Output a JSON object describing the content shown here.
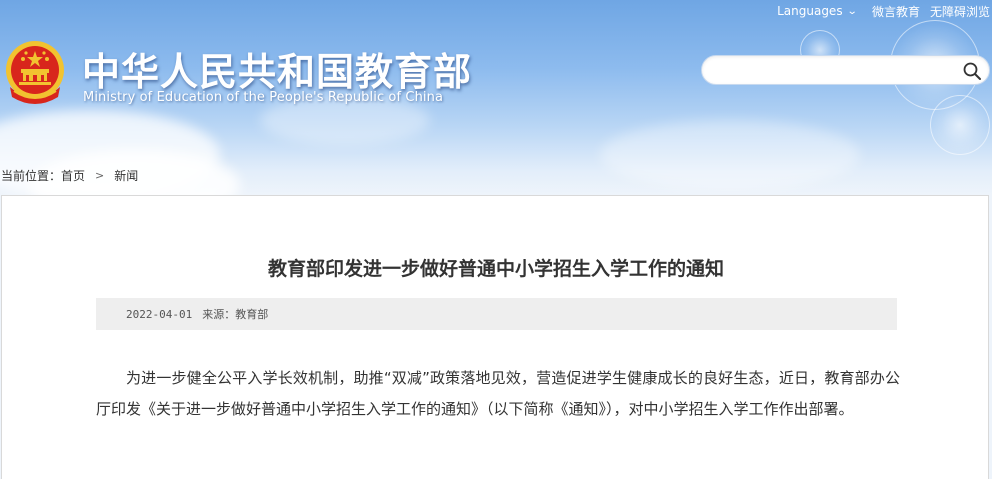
{
  "topbar": {
    "languages_label": "Languages",
    "weibo_label": "微言教育",
    "accessibility_label": "无障碍浏览"
  },
  "header": {
    "title_zh": "中华人民共和国教育部",
    "title_en": "Ministry of Education of the People's Republic of China",
    "search_placeholder": "",
    "icons": {
      "emblem": "national-emblem-icon",
      "search": "search-icon"
    },
    "colors": {
      "sky": "#6fa6e4",
      "emblem_red": "#d8261c",
      "emblem_gold": "#f2c330"
    }
  },
  "breadcrumb": {
    "prefix": "当前位置：",
    "items": [
      "首页",
      "新闻"
    ],
    "separator": ">"
  },
  "article": {
    "title": "教育部印发进一步做好普通中小学招生入学工作的通知",
    "date": "2022-04-01",
    "source": "来源：教育部",
    "paragraph": "为进一步健全公平入学长效机制，助推“双减”政策落地见效，营造促进学生健康成长的良好生态，近日，教育部办公厅印发《关于进一步做好普通中小学招生入学工作的通知》（以下简称《通知》），对中小学招生入学工作作出部署。"
  }
}
